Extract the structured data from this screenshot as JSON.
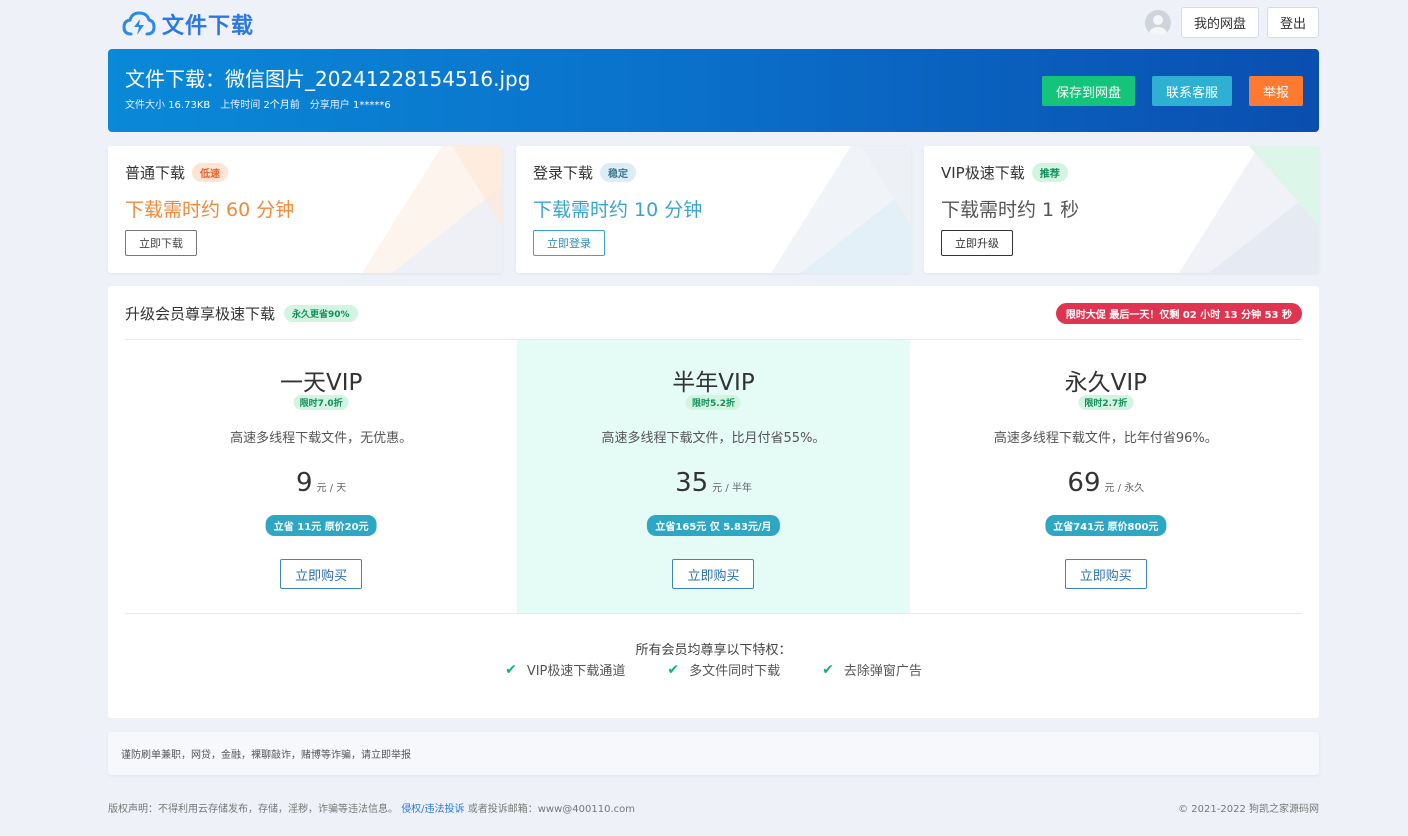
{
  "header": {
    "logo_text": "文件下载",
    "my_disk": "我的网盘",
    "logout": "登出"
  },
  "banner": {
    "title_prefix": "文件下载：",
    "file_name": "微信图片_20241228154516.jpg",
    "size_label": "文件大小",
    "size_value": "16.73KB",
    "upload_label": "上传时间",
    "upload_value": "2个月前",
    "sharer_label": "分享用户",
    "sharer_value": "1*****6",
    "save_button": "保存到网盘",
    "support_button": "联系客服",
    "report_button": "举报"
  },
  "download_options": [
    {
      "name": "普通下载",
      "tag": "低速",
      "time": "下载需时约 60 分钟",
      "button": "立即下载",
      "accent": "#f08a3c"
    },
    {
      "name": "登录下载",
      "tag": "稳定",
      "time": "下载需时约 10 分钟",
      "button": "立即登录",
      "accent": "#3aa5cc"
    },
    {
      "name": "VIP极速下载",
      "tag": "推荐",
      "time": "下载需时约 1 秒",
      "button": "立即升级",
      "accent": "#555555"
    }
  ],
  "vip": {
    "title": "升级会员尊享极速下载",
    "badge": "永久更省90%",
    "promo": "限时大促 最后一天！仅剩 02 小时 13 分钟 53 秒",
    "plans": [
      {
        "name": "一天VIP",
        "discount": "限时7.0折",
        "desc": "高速多线程下载文件，无优惠。",
        "price": "9",
        "unit": "元 / 天",
        "save": "立省 11元 原价20元",
        "buy": "立即购买"
      },
      {
        "name": "半年VIP",
        "discount": "限时5.2折",
        "desc": "高速多线程下载文件，比月付省55%。",
        "price": "35",
        "unit": "元 / 半年",
        "save": "立省165元 仅 5.83元/月",
        "buy": "立即购买"
      },
      {
        "name": "永久VIP",
        "discount": "限时2.7折",
        "desc": "高速多线程下载文件，比年付省96%。",
        "price": "69",
        "unit": "元 / 永久",
        "save": "立省741元 原价800元",
        "buy": "立即购买"
      }
    ],
    "perks_title": "所有会员均尊享以下特权：",
    "perks": [
      "VIP极速下载通道",
      "多文件同时下载",
      "去除弹窗广告"
    ]
  },
  "warning": "谨防刷单兼职，网贷，金融，裸聊敲诈，赌博等诈骗，请立即举报",
  "footer": {
    "copyright_notice": "版权声明：不得利用云存储发布，存储，淫秽，诈骗等违法信息。",
    "report_link": "侵权/违法投诉",
    "email_text": "或者投诉邮箱：www@400110.com",
    "right": "© 2021-2022 狗凯之家源码网"
  }
}
